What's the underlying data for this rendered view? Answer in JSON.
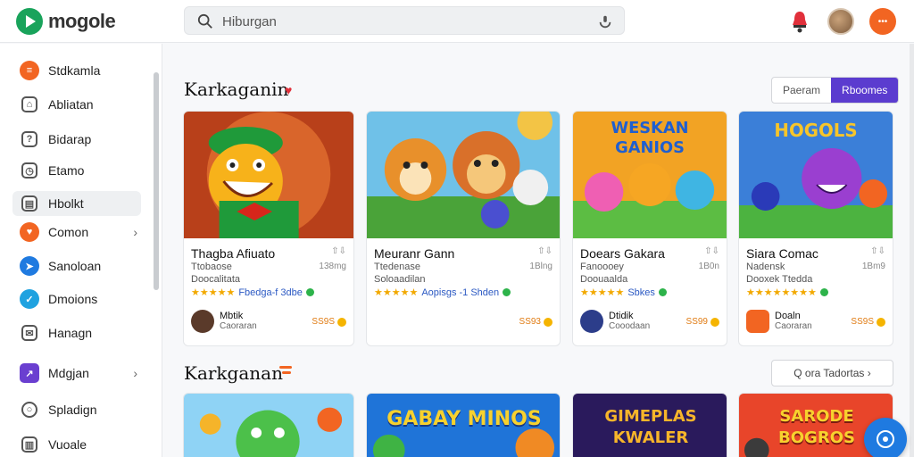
{
  "header": {
    "logo_text": "mogole",
    "search_placeholder": "Hiburgan"
  },
  "sidebar": {
    "items": [
      {
        "label": "Stdkamla",
        "icon": "news-icon",
        "color": "#f26522"
      },
      {
        "label": "Abliatan",
        "icon": "home-icon",
        "color": "outline"
      },
      {
        "label": "Bidarap",
        "icon": "question-icon",
        "color": "outline"
      },
      {
        "label": "Etamo",
        "icon": "clock-icon",
        "color": "outline"
      },
      {
        "label": "Hbolkt",
        "icon": "library-icon",
        "color": "outline"
      },
      {
        "label": "Comon",
        "icon": "heart-icon",
        "color": "#f26522"
      },
      {
        "label": "Sanoloan",
        "icon": "send-icon",
        "color": "#1f7ae0"
      },
      {
        "label": "Dmoions",
        "icon": "check-icon",
        "color": "#1fa2e0"
      },
      {
        "label": "Hanagn",
        "icon": "mail-icon",
        "color": "outline"
      },
      {
        "label": "Mdgjan",
        "icon": "chart-icon",
        "color": "#6a3fd0"
      },
      {
        "label": "Spladign",
        "icon": "chat-icon",
        "color": "outline"
      },
      {
        "label": "Vuoale",
        "icon": "building-icon",
        "color": "outline"
      }
    ]
  },
  "sections": [
    {
      "title": "Karkaganin",
      "toggle": [
        "Paeram",
        "Rboomes"
      ],
      "cards": [
        {
          "title": "Thagba Afiuato",
          "meta": "⇧⇩",
          "sub": "Ttobaose",
          "size": "138mg",
          "dev": "Doocalitata",
          "rating": "★★★★★",
          "tag": "Fbedga-f 3dbe",
          "pub": "Mbtik",
          "pub_sub": "Caoraran",
          "price": "SS9S"
        },
        {
          "title": "Meuranr Gann",
          "meta": "⇧⇩",
          "sub": "Ttedenase",
          "size": "1Blng",
          "dev": "Soloaadilan",
          "rating": "★★★★★",
          "tag": "Aopisgs -1 Shden",
          "pub": "",
          "pub_sub": "",
          "price": "SS93"
        },
        {
          "title": "Doears Gakara",
          "meta": "⇧⇩",
          "sub": "Fanoooey",
          "size": "1B0n",
          "dev": "Doouaalda",
          "rating": "★★★★★",
          "tag": "Sbkes",
          "pub": "Dtidik",
          "pub_sub": "Cooodaan",
          "price": "SS99"
        },
        {
          "title": "Siara Comac",
          "meta": "⇧⇩",
          "sub": "Nadensk",
          "size": "1Bm9",
          "dev": "Dooxek Ttedda",
          "rating": "★★★★★★★★",
          "tag": "",
          "pub": "Doaln",
          "pub_sub": "Caoraran",
          "price": "SS9S"
        }
      ]
    },
    {
      "title": "Karkganan",
      "more_label": "Q ora Tadortas ›",
      "cards": [
        {
          "banner": ""
        },
        {
          "banner": "GABAY MINOS"
        },
        {
          "banner": "GIMEPLAS KWALER"
        },
        {
          "banner": "SARODE BOGROS"
        }
      ]
    }
  ]
}
